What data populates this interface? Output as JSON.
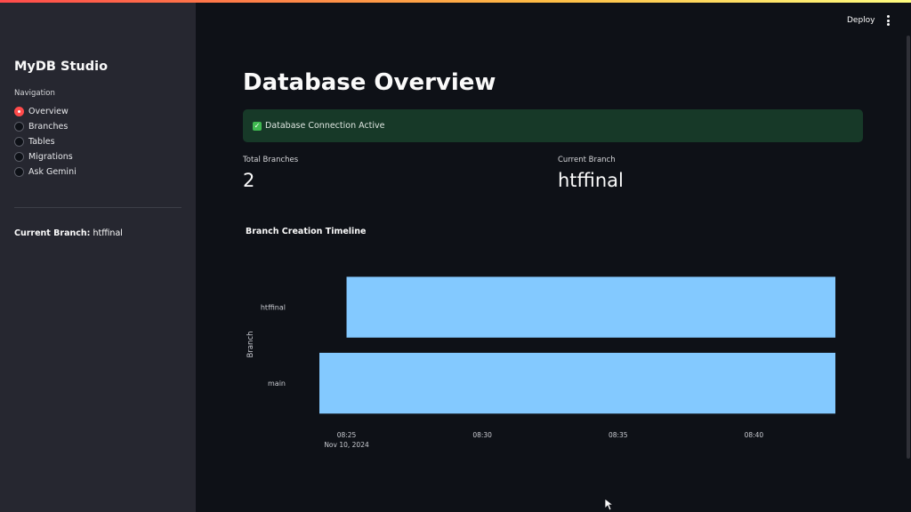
{
  "sidebar": {
    "app_title": "MyDB Studio",
    "nav_label": "Navigation",
    "nav_items": [
      {
        "label": "Overview",
        "selected": true
      },
      {
        "label": "Branches",
        "selected": false
      },
      {
        "label": "Tables",
        "selected": false
      },
      {
        "label": "Migrations",
        "selected": false
      },
      {
        "label": "Ask Gemini",
        "selected": false
      }
    ],
    "current_branch_label": "Current Branch:",
    "current_branch_value": "htffinal"
  },
  "header": {
    "deploy_label": "Deploy",
    "menu_icon": "kebab-menu-icon"
  },
  "main": {
    "title": "Database Overview",
    "alert": {
      "icon": "check-icon",
      "text": "Database Connection Active",
      "color": "#173928"
    },
    "metrics": [
      {
        "label": "Total Branches",
        "value": "2"
      },
      {
        "label": "Current Branch",
        "value": "htffinal"
      }
    ]
  },
  "chart_data": {
    "type": "bar",
    "orientation": "horizontal-timeline",
    "title": "Branch Creation Timeline",
    "ylabel": "Branch",
    "xlabel": "",
    "categories": [
      "htffinal",
      "main"
    ],
    "series": [
      {
        "category": "htffinal",
        "start": "08:25",
        "end": "08:43"
      },
      {
        "category": "main",
        "start": "08:24",
        "end": "08:43"
      }
    ],
    "x_ticks": [
      "08:25",
      "08:30",
      "08:35",
      "08:40"
    ],
    "x_tick_sublabel": "Nov 10, 2024",
    "xlim": [
      "08:24",
      "08:43"
    ],
    "bar_color": "#83c9ff",
    "grid": false
  }
}
